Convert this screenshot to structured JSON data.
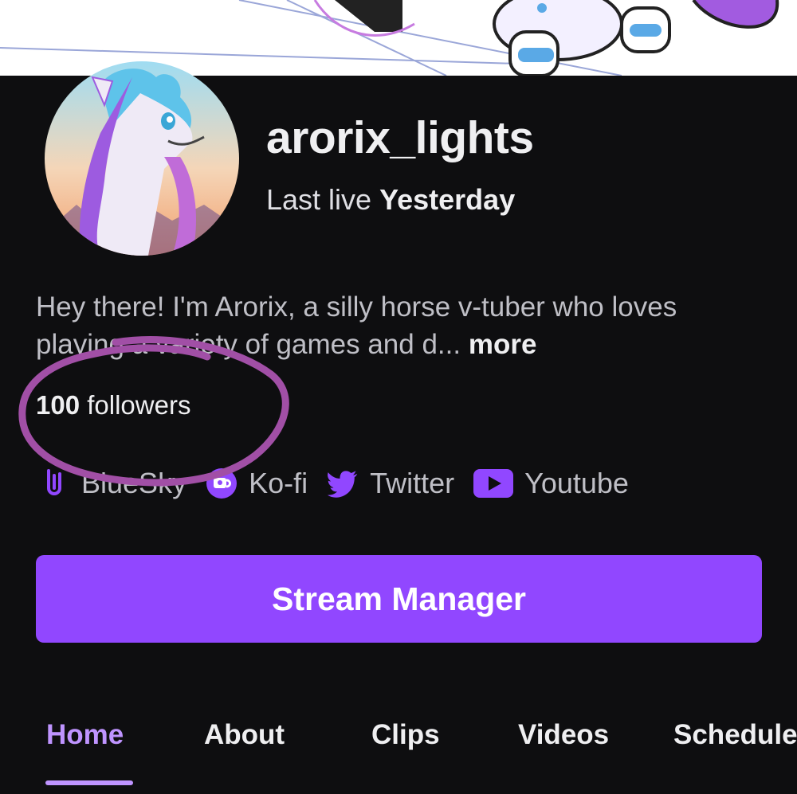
{
  "colors": {
    "background": "#0e0e10",
    "accent": "#9147ff",
    "accent_light": "#bf94ff",
    "annotation": "#a14fa6"
  },
  "profile": {
    "username": "arorix_lights",
    "last_live_label": "Last live",
    "last_live_value": "Yesterday",
    "bio": "Hey there! I'm Arorix, a silly horse v-tuber who loves playing a variety of games and d...",
    "more_label": "more",
    "followers_count": "100",
    "followers_label": "followers"
  },
  "socials": [
    {
      "icon": "bluesky-icon",
      "label": "BlueSky"
    },
    {
      "icon": "kofi-icon",
      "label": "Ko-fi"
    },
    {
      "icon": "twitter-icon",
      "label": "Twitter"
    },
    {
      "icon": "youtube-icon",
      "label": "Youtube"
    }
  ],
  "cta": {
    "label": "Stream Manager"
  },
  "tabs": [
    {
      "label": "Home",
      "active": true
    },
    {
      "label": "About"
    },
    {
      "label": "Clips"
    },
    {
      "label": "Videos"
    },
    {
      "label": "Schedule"
    }
  ]
}
